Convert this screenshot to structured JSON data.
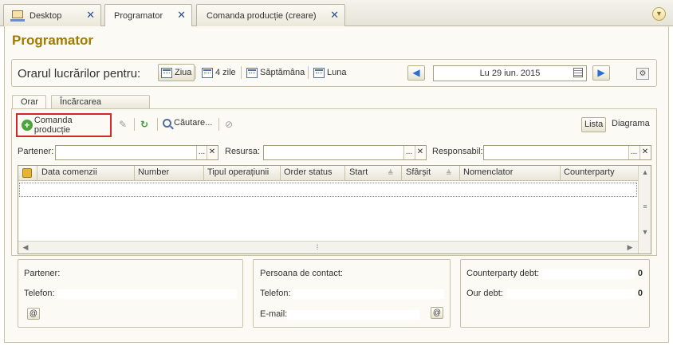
{
  "tabs": [
    {
      "label": "Desktop",
      "close": "✕"
    },
    {
      "label": "Programator",
      "close": "✕"
    },
    {
      "label": "Comanda producție (creare)",
      "close": "✕"
    }
  ],
  "page": {
    "title": "Programator"
  },
  "schedule": {
    "label": "Orarul lucrărilor pentru:",
    "views": [
      "Ziua",
      "4 zile",
      "Săptămâna",
      "Luna"
    ],
    "selected_view": "Ziua",
    "date": "Lu 29 iun. 2015",
    "prev_icon": "arrow-left-icon",
    "next_icon": "arrow-right-icon"
  },
  "inner_tabs": [
    "Orar",
    "Încărcarea resurselor"
  ],
  "toolbar": {
    "add_label": "Comanda producție",
    "search_label": "Căutare...",
    "list_label": "Lista",
    "diagram_label": "Diagrama"
  },
  "filters": {
    "partner_label": "Partener:",
    "resource_label": "Resursa:",
    "responsible_label": "Responsabil:",
    "dots": "...",
    "clear": "✕"
  },
  "grid": {
    "columns": [
      "Data comenzii",
      "Number",
      "Tipul operațiunii",
      "Order status",
      "Start",
      "Sfârșit",
      "Nomenclator",
      "Counterparty"
    ],
    "rows": []
  },
  "partner_panel": {
    "partner_label": "Partener:",
    "phone_label": "Telefon:",
    "at": "@"
  },
  "contact_panel": {
    "contact_label": "Persoana de contact:",
    "phone_label": "Telefon:",
    "email_label": "E-mail:",
    "at": "@"
  },
  "debt_panel": {
    "counterparty_debt_label": "Counterparty debt:",
    "counterparty_debt": "0",
    "our_debt_label": "Our debt:",
    "our_debt": "0"
  }
}
